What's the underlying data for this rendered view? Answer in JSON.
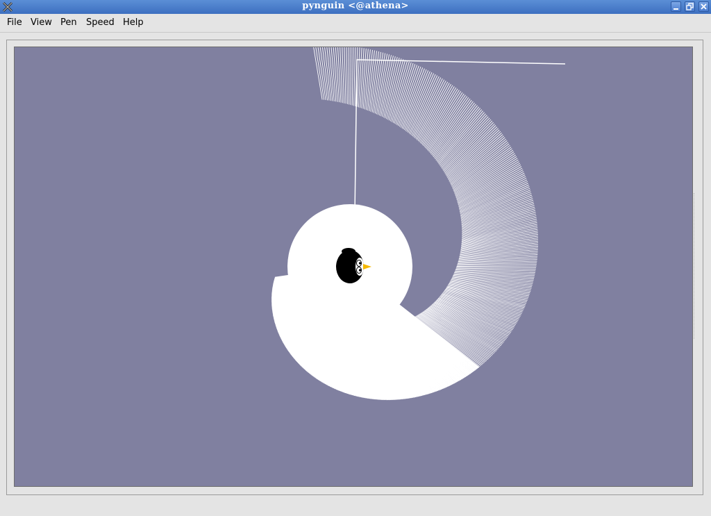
{
  "window": {
    "title": "pynguin  <@athena>",
    "controls": [
      "minimize",
      "maximize",
      "close"
    ]
  },
  "menu": {
    "items": [
      "File",
      "View",
      "Pen",
      "Speed",
      "Help"
    ]
  },
  "canvas": {
    "background": "#8080a0",
    "pen_color": "#ffffff"
  },
  "icons": {
    "app": "pynguin-x-icon",
    "turtle": "penguin-icon"
  }
}
